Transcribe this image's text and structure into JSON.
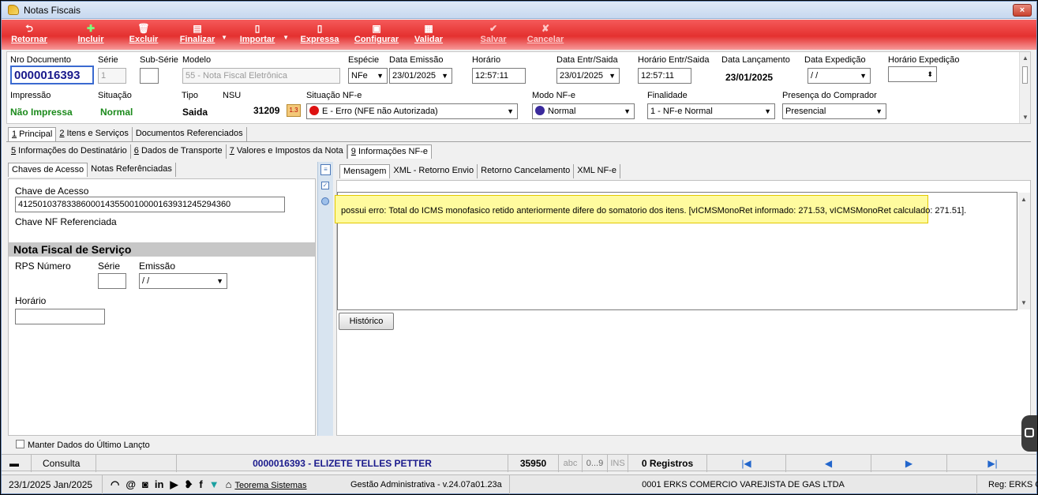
{
  "window": {
    "title": "Notas Fiscais",
    "close": "×"
  },
  "toolbar": {
    "retornar": "Retornar",
    "incluir": "Incluir",
    "excluir": "Excluir",
    "finalizar": "Finalizar",
    "importar": "Importar",
    "expressa": "Expressa",
    "configurar": "Configurar",
    "validar": "Validar",
    "salvar": "Salvar",
    "cancelar": "Cancelar"
  },
  "header": {
    "labels": {
      "nro_documento": "Nro Documento",
      "serie": "Série",
      "sub_serie": "Sub-Série",
      "modelo": "Modelo",
      "especie": "Espécie",
      "data_emissao": "Data Emissão",
      "horario": "Horário",
      "data_entr_saida": "Data Entr/Saida",
      "horario_entr_saida": "Horário Entr/Saida",
      "data_lancamento": "Data Lançamento",
      "data_expedicao": "Data Expedição",
      "horario_expedicao": "Horário Expedição",
      "impressao": "Impressão",
      "situacao": "Situação",
      "tipo": "Tipo",
      "nsu": "NSU",
      "situacao_nfe": "Situação NF-e",
      "modo_nfe": "Modo NF-e",
      "finalidade": "Finalidade",
      "presenca_comprador": "Presença do Comprador"
    },
    "values": {
      "nro_documento": "0000016393",
      "serie": "1",
      "sub_serie": "",
      "modelo": "55 - Nota Fiscal Eletrônica",
      "especie": "NFe",
      "data_emissao": "23/01/2025",
      "horario": "12:57:11",
      "data_entr_saida": "23/01/2025",
      "horario_entr_saida": "12:57:11",
      "data_lancamento": "23/01/2025",
      "data_expedicao": " / /",
      "horario_expedicao": "",
      "impressao": "Não Impressa",
      "situacao": "Normal",
      "tipo": "Saida",
      "nsu": "31209",
      "nsu_badge": "1.3",
      "situacao_nfe": "E - Erro (NFE não Autorizada)",
      "modo_nfe": "Normal",
      "finalidade": "1 - NF-e Normal",
      "presenca_comprador": "Presencial"
    }
  },
  "tabs_main": [
    {
      "key": "1",
      "label": " Principal"
    },
    {
      "key": "2",
      "label": " Itens e Serviços"
    },
    {
      "key": "",
      "label": "Documentos Referenciados"
    }
  ],
  "tabs_sub": [
    {
      "key": "5",
      "label": " Informações do Destinatário"
    },
    {
      "key": "6",
      "label": " Dados de Transporte"
    },
    {
      "key": "7",
      "label": " Valores e Impostos da Nota"
    },
    {
      "key": "9",
      "label": " Informações NF-e"
    }
  ],
  "left": {
    "tabs": [
      "Chaves de Acesso",
      "Notas Referênciadas"
    ],
    "chave_acesso_label": "Chave de Acesso",
    "chave_acesso_value": "41250103783386000143550010000163931245294360",
    "chave_nf_ref_label": "Chave NF Referenciada",
    "nfs_title": "Nota Fiscal de Serviço",
    "rps_numero": "RPS Número",
    "serie": "Série",
    "emissao": "Emissão",
    "emissao_value": " / /",
    "horario": "Horário"
  },
  "right": {
    "tabs": [
      "Mensagem",
      "XML - Retorno Envio",
      "Retorno Cancelamento",
      "XML NF-e"
    ],
    "message": "possui erro: Total do ICMS monofasico retido anteriormente difere do somatorio dos itens. [vICMSMonoRet informado: 271.53, vICMSMonoRet calculado: 271.51].",
    "historico": "Histórico"
  },
  "manter_dados": "Manter Dados do Último Lançto",
  "status": {
    "consulta": "Consulta",
    "documento": "0000016393 - ELIZETE TELLES PETTER",
    "codigo": "35950",
    "abc": "abc",
    "digits": "0...9",
    "ins": "INS",
    "registros": "0 Registros"
  },
  "bottom": {
    "date": "23/1/2025 Jan/2025",
    "teorema": "Teorema Sistemas",
    "versao": "Gestão Administrativa - v.24.07a01.23a",
    "empresa": "0001 ERKS COMERCIO VAREJISTA DE GAS LTDA",
    "reg": "Reg: ERKS C"
  },
  "colors": {
    "toolbar": "#e4302f",
    "highlight": "#fffb9e",
    "navy": "#1a1a8c",
    "green": "#1b8a1b"
  }
}
